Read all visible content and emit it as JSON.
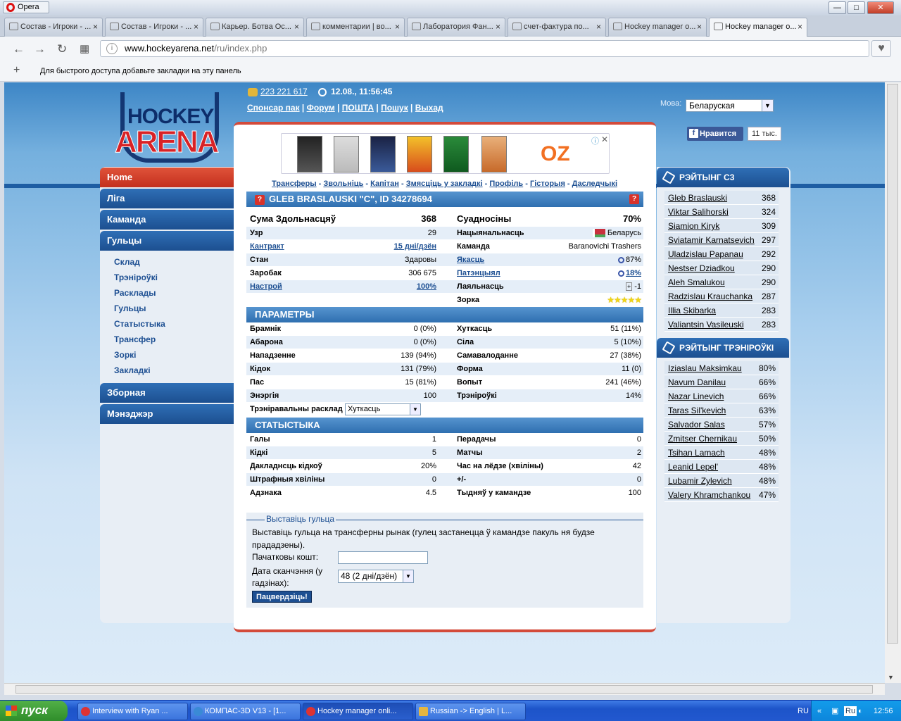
{
  "browser": {
    "app_name": "Opera",
    "tabs": [
      "Состав - Игроки - ...",
      "Состав - Игроки - ...",
      "Карьер. Ботва Ос...",
      "комментарии | во...",
      "Лаборатория Фан...",
      "счет-фактура по...",
      "Hockey manager o...",
      "Hockey manager o..."
    ],
    "url_host": "www.hockeyarena.net",
    "url_path": "/ru/index.php",
    "bookmark_hint": "Для быстрого доступа добавьте закладки на эту панель"
  },
  "site": {
    "logo_top": "HOCKEY",
    "logo_bottom": "ARENA",
    "money": "223 221 617",
    "datetime": "12.08., 11:56:45",
    "top_links": [
      "Спонсар пак",
      "Форум",
      "ПОШТА",
      "Пошук",
      "Выхад"
    ],
    "lang_label": "Мова:",
    "lang_value": "Беларуская",
    "fb_like": "Нравится",
    "fb_count": "11 тыс.",
    "ad_brand": "OZ"
  },
  "left_menu": {
    "main": [
      "Home",
      "Ліга",
      "Каманда",
      "Гульцы",
      "Зборная",
      "Мэнэджэр"
    ],
    "sub": [
      "Склад",
      "Трэніроўкі",
      "Расклады",
      "Гульцы",
      "Статыстыка",
      "Трансфер",
      "Зоркі",
      "Закладкі"
    ]
  },
  "player_nav": [
    "Трансферы",
    "Звольніць",
    "Капітан",
    "Змясціць у закладкі",
    "Профіль",
    "Гісторыя",
    "Даследчыкі"
  ],
  "player": {
    "header": "GLEB BRASLAUSKI \"C\", ID 34278694",
    "sum_label": "Сума Здольнасцяў",
    "sum_value": "368",
    "ratio_label": "Суадносіны",
    "ratio_value": "70%",
    "info_left": [
      {
        "label": "Узр",
        "value": "29"
      },
      {
        "label": "Кантракт",
        "value": "15 дні/дзён"
      },
      {
        "label": "Стан",
        "value": "Здаровы"
      },
      {
        "label": "Заробак",
        "value": "306 675"
      },
      {
        "label": "Настрой",
        "value": "100%"
      }
    ],
    "info_right": [
      {
        "label": "Нацыянальнасць",
        "value": "Беларусь"
      },
      {
        "label": "Каманда",
        "value": "Baranovichi Trashers"
      },
      {
        "label": "Якасць",
        "value": "87%"
      },
      {
        "label": "Патэнцыял",
        "value": "18%"
      },
      {
        "label": "Лаяльнасць",
        "value": "-1"
      },
      {
        "label": "Зорка",
        "value": "★★★★★"
      }
    ]
  },
  "params": {
    "title": "ПАРАМЕТРЫ",
    "left": [
      {
        "label": "Брамнік",
        "value": "0 (0%)"
      },
      {
        "label": "Абарона",
        "value": "0 (0%)"
      },
      {
        "label": "Нападзенне",
        "value": "139 (94%)"
      },
      {
        "label": "Кідок",
        "value": "131 (79%)"
      },
      {
        "label": "Пас",
        "value": "15 (81%)"
      },
      {
        "label": "Энэргія",
        "value": "100"
      }
    ],
    "right": [
      {
        "label": "Хуткасць",
        "value": "51 (11%)"
      },
      {
        "label": "Сіла",
        "value": "5 (10%)"
      },
      {
        "label": "Самавалоданне",
        "value": "27 (38%)"
      },
      {
        "label": "Форма",
        "value": "11 (0)"
      },
      {
        "label": "Вопыт",
        "value": "241 (46%)"
      },
      {
        "label": "Трэніроўкі",
        "value": "14%"
      }
    ],
    "training_label": "Трэніравальны расклад",
    "training_value": "Хуткасць"
  },
  "stats": {
    "title": "СТАТЫСТЫКА",
    "left": [
      {
        "label": "Галы",
        "value": "1"
      },
      {
        "label": "Кідкі",
        "value": "5"
      },
      {
        "label": "Дакладнсць кідкоў",
        "value": "20%"
      },
      {
        "label": "Штрафныя хвіліны",
        "value": "0"
      },
      {
        "label": "Адзнака",
        "value": "4.5"
      }
    ],
    "right": [
      {
        "label": "Перадачы",
        "value": "0"
      },
      {
        "label": "Матчы",
        "value": "2"
      },
      {
        "label": "Час на лёдзе (хвіліны)",
        "value": "42"
      },
      {
        "label": "+/-",
        "value": "0"
      },
      {
        "label": "Тыдняў у камандзе",
        "value": "100"
      }
    ]
  },
  "sell": {
    "legend": "Выставіць гульца",
    "desc": "Выставіць гульца на трансферны рынак (гулец застанецца ў камандзе пакуль ня будзе прададзены).",
    "start_price_label": "Пачатковы кошт:",
    "start_price_value": "",
    "end_date_label": "Дата сканчэння (у гадзінах):",
    "end_date_value": "48 (2 дні/дзён)",
    "confirm": "Пацвердзіць!"
  },
  "rating_c3": {
    "title": "РЭЙТЫНГ C3",
    "rows": [
      {
        "name": "Gleb Braslauski",
        "value": "368"
      },
      {
        "name": "Viktar Salihorski",
        "value": "324"
      },
      {
        "name": "Siamion Kiryk",
        "value": "309"
      },
      {
        "name": "Sviatamir Karnatsevich",
        "value": "297"
      },
      {
        "name": "Uladzislau Papanau",
        "value": "292"
      },
      {
        "name": "Nestser Dziadkou",
        "value": "290"
      },
      {
        "name": "Aleh Smalukou",
        "value": "290"
      },
      {
        "name": "Radzislau Krauchanka",
        "value": "287"
      },
      {
        "name": "Illia Skibarka",
        "value": "283"
      },
      {
        "name": "Valiantsin Vasileuski",
        "value": "283"
      }
    ]
  },
  "rating_training": {
    "title": "РЭЙТЫНГ ТРЭНІРОЎКІ",
    "rows": [
      {
        "name": "Iziaslau Maksimkau",
        "value": "80%"
      },
      {
        "name": "Navum Danilau",
        "value": "66%"
      },
      {
        "name": "Nazar Linevich",
        "value": "66%"
      },
      {
        "name": "Taras Sil'kevich",
        "value": "63%"
      },
      {
        "name": "Salvador Salas",
        "value": "57%"
      },
      {
        "name": "Zmitser Chernikau",
        "value": "50%"
      },
      {
        "name": "Tsihan Lamach",
        "value": "48%"
      },
      {
        "name": "Leanid Lepel'",
        "value": "48%"
      },
      {
        "name": "Lubamir Zylevich",
        "value": "48%"
      },
      {
        "name": "Valery Khramchankou",
        "value": "47%"
      }
    ]
  },
  "taskbar": {
    "start": "пуск",
    "tasks": [
      "Interview with Ryan ...",
      "КОМПАС-3D V13 - [1...",
      "Hockey manager onli...",
      "Russian -> English | L..."
    ],
    "lang": "RU",
    "tray_lang": "Ru",
    "clock": "12:56"
  }
}
